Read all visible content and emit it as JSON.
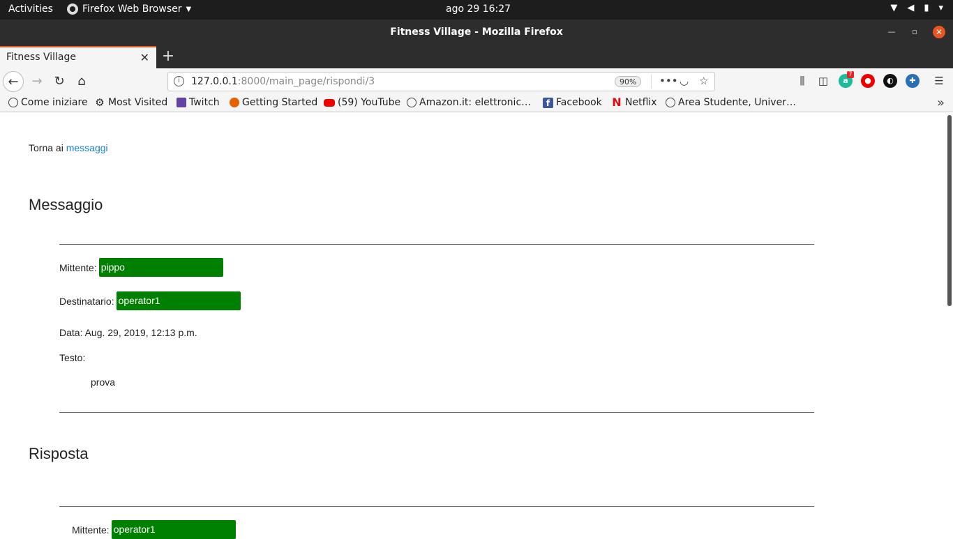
{
  "system_bar": {
    "activities": "Activities",
    "app_name": "Firefox Web Browser",
    "clock": "ago 29  16:27"
  },
  "window": {
    "title": "Fitness Village - Mozilla Firefox"
  },
  "tabs": [
    {
      "label": "Fitness Village"
    }
  ],
  "navbar": {
    "url_host": "127.0.0.1",
    "url_rest": ":8000/main_page/rispondi/3",
    "zoom": "90%",
    "addon_badge": "7"
  },
  "bookmarks": [
    {
      "label": "Come iniziare",
      "icon": "globe-icon"
    },
    {
      "label": "Most Visited",
      "icon": "gear-icon"
    },
    {
      "label": "Twitch",
      "icon": "twitch-icon"
    },
    {
      "label": "Getting Started",
      "icon": "firefox-icon"
    },
    {
      "label": "(59) YouTube",
      "icon": "youtube-icon"
    },
    {
      "label": "Amazon.it: elettronic…",
      "icon": "globe-icon"
    },
    {
      "label": "Facebook",
      "icon": "facebook-icon"
    },
    {
      "label": "Netflix",
      "icon": "netflix-icon"
    },
    {
      "label": "Area Studente, Univer…",
      "icon": "globe-icon"
    }
  ],
  "page": {
    "back_prefix": "Torna ai",
    "back_link": "messaggi",
    "message_heading": "Messaggio",
    "message": {
      "sender_label": "Mittente:",
      "sender": "pippo",
      "recipient_label": "Destinatario:",
      "recipient": "operator1",
      "date": "Data: Aug. 29, 2019, 12:13 p.m.",
      "text_label": "Testo:",
      "text": "prova"
    },
    "reply_heading": "Risposta",
    "reply": {
      "sender_label": "Mittente:",
      "sender": "operator1"
    }
  },
  "colors": {
    "pill_green": "#008000",
    "link_blue": "#1a7fd4",
    "ubuntu_orange": "#e95420"
  }
}
